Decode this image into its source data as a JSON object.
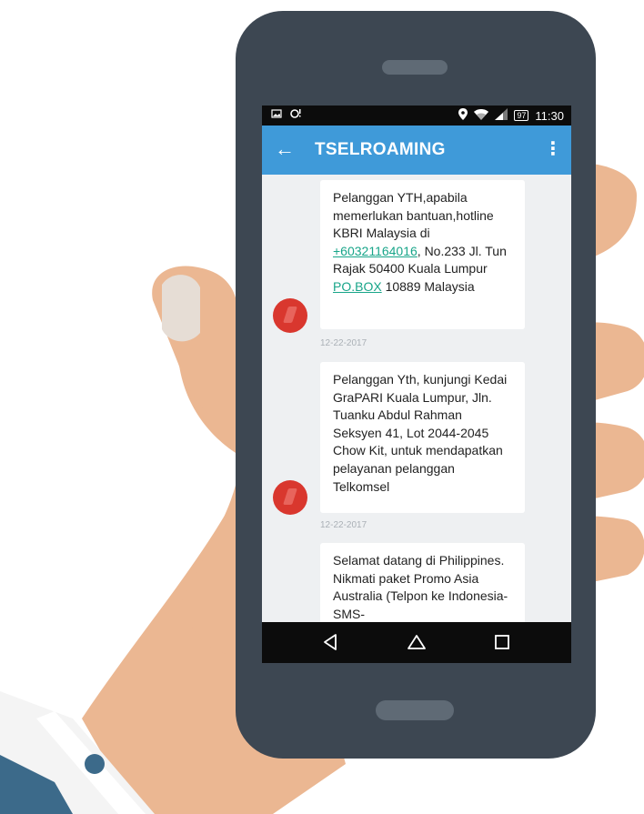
{
  "status_bar": {
    "battery": "97",
    "time": "11:30",
    "icons": [
      "image-icon",
      "alarm-icon",
      "location-icon",
      "wifi-icon",
      "signal-icon",
      "battery-icon"
    ]
  },
  "app_bar": {
    "title": "TSELROAMING",
    "back_icon": "arrow-left-icon",
    "menu_icon": "more-vert-icon"
  },
  "messages": [
    {
      "text_before": "Pelanggan YTH,apabila memerlukan bantuan,hotline KBRI Malaysia di ",
      "phone_link": "+60321164016",
      "text_middle": ", No.233 Jl. Tun Rajak 50400 Kuala Lumpur ",
      "pobox_link": "PO.BOX",
      "text_after": " 10889 Malaysia",
      "date": "12-22-2017"
    },
    {
      "text": "Pelanggan Yth, kunjungi Kedai GraPARI Kuala Lumpur, Jln. Tuanku Abdul Rahman Seksyen 41, Lot 2044-2045 Chow Kit, untuk mendapatkan pelayanan pelanggan Telkomsel",
      "date": "12-22-2017"
    },
    {
      "text": "Selamat datang di Philippines. Nikmati paket Promo Asia Australia (Telpon ke Indonesia-SMS-"
    }
  ],
  "nav_bar": {
    "back": "triangle-back-icon",
    "home": "home-outline-icon",
    "recents": "square-recents-icon"
  },
  "colors": {
    "app_bar": "#3f9ad9",
    "phone_body": "#3d4752",
    "skin": "#ebb792",
    "link": "#18a589",
    "avatar": "#d9372e"
  }
}
